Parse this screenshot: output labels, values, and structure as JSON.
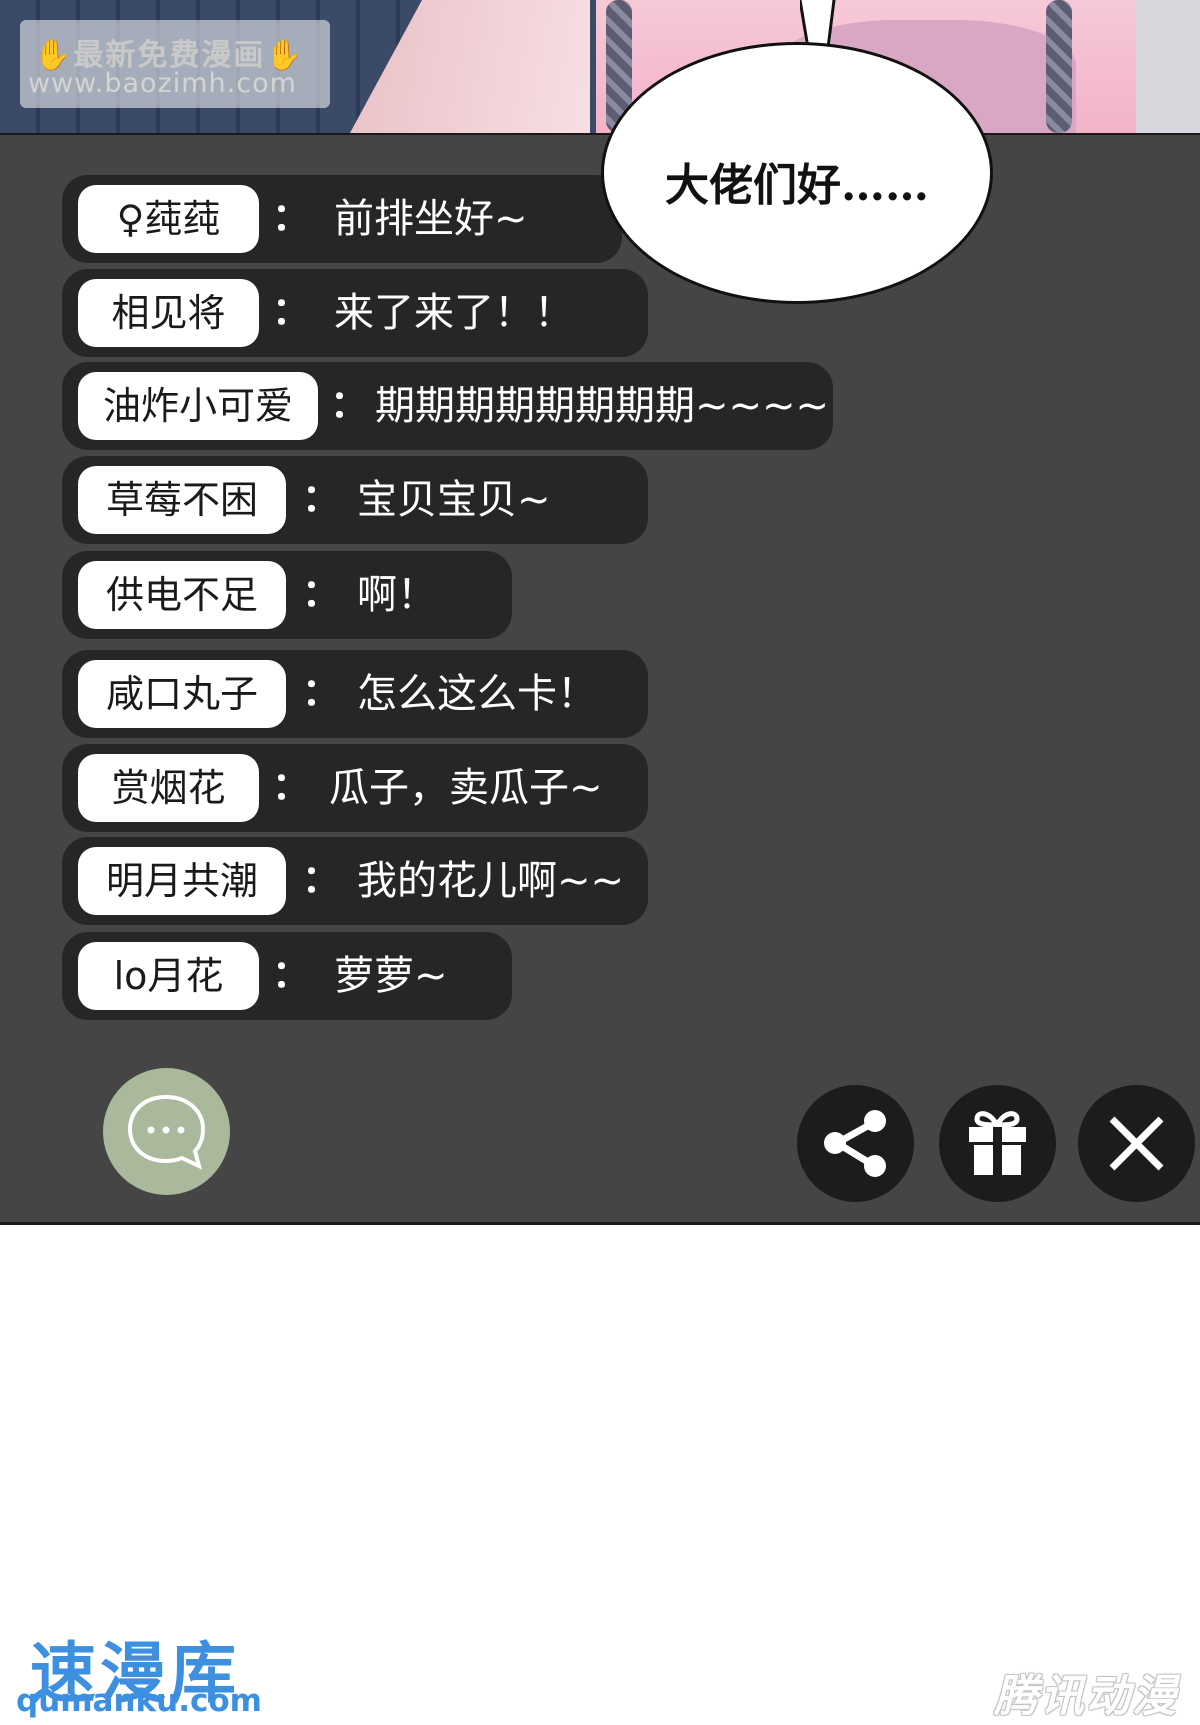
{
  "watermark": {
    "top_badge_line1": "最新免费漫画",
    "top_badge_line2": "www.baozimh.com",
    "site_title": "速漫库",
    "site_url": "qumanku.com",
    "publisher_mark": "腾讯动漫"
  },
  "speech_bubble": {
    "text": "大佬们好……"
  },
  "chat": {
    "separator": "：",
    "messages": [
      {
        "user": "♀莼莼",
        "text": "前排坐好~"
      },
      {
        "user": "相见将",
        "text": "来了来了！！"
      },
      {
        "user": "油炸小可爱",
        "text": "期期期期期期期期~~~~"
      },
      {
        "user": "草莓不困",
        "text": "宝贝宝贝~"
      },
      {
        "user": "供电不足",
        "text": "啊！"
      },
      {
        "user": "咸口丸子",
        "text": "怎么这么卡！"
      },
      {
        "user": "赏烟花",
        "text": "瓜子，卖瓜子~"
      },
      {
        "user": "明月共潮",
        "text": "我的花儿啊~~"
      },
      {
        "user": "lo月花",
        "text": "萝萝~"
      }
    ]
  },
  "controls": {
    "chat_icon": "speech-bubble-ellipsis-icon",
    "share_icon": "share-icon",
    "gift_icon": "gift-icon",
    "close_icon": "close-icon"
  },
  "colors": {
    "panel": "#454545",
    "row": "#262626",
    "chat_button": "#aab89b",
    "action_button": "#1c1c1c",
    "site_blue": "#3d8fe0"
  }
}
